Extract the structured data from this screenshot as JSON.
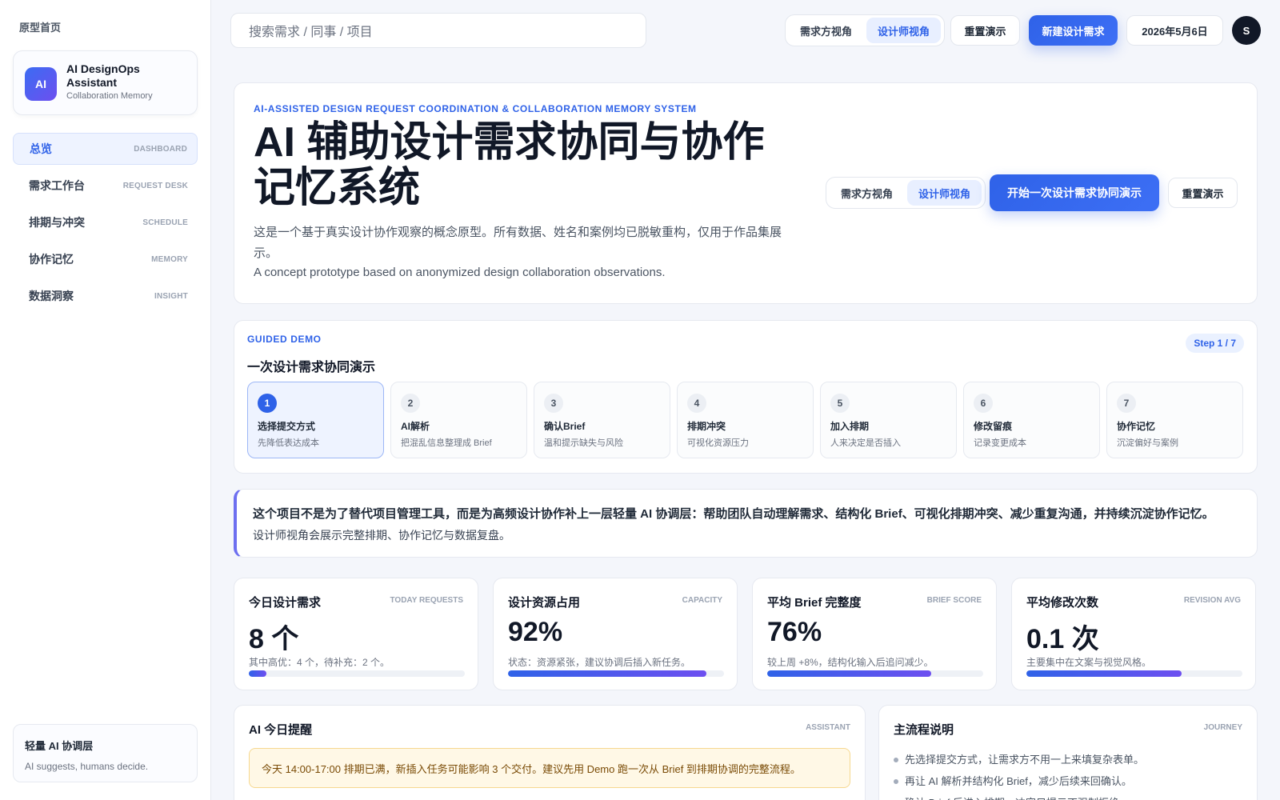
{
  "sidebar": {
    "home_label": "原型首页",
    "brand": {
      "logo": "AI",
      "name": "AI DesignOps Assistant",
      "subtitle": "Collaboration Memory"
    },
    "items": [
      {
        "label": "总览",
        "en": "DASHBOARD",
        "active": true
      },
      {
        "label": "需求工作台",
        "en": "REQUEST DESK"
      },
      {
        "label": "排期与冲突",
        "en": "SCHEDULE"
      },
      {
        "label": "协作记忆",
        "en": "MEMORY"
      },
      {
        "label": "数据洞察",
        "en": "INSIGHT"
      }
    ],
    "footer": {
      "title": "轻量 AI 协调层",
      "subtitle": "AI suggests, humans decide."
    }
  },
  "topbar": {
    "search_placeholder": "搜索需求 / 同事 / 项目",
    "view_toggle": [
      "需求方视角",
      "设计师视角"
    ],
    "active_view": "设计师视角",
    "reset_label": "重置演示",
    "new_request_label": "新建设计需求",
    "date": "2026年5月6日",
    "avatar_initial": "S"
  },
  "hero": {
    "eyebrow": "AI-ASSISTED DESIGN REQUEST COORDINATION & COLLABORATION MEMORY SYSTEM",
    "title": "AI 辅助设计需求协同与协作记忆系统",
    "description_zh": "这是一个基于真实设计协作观察的概念原型。所有数据、姓名和案例均已脱敏重构，仅用于作品集展示。",
    "description_en": "A concept prototype based on anonymized design collaboration observations.",
    "view_toggle": [
      "需求方视角",
      "设计师视角"
    ],
    "start_demo_label": "开始一次设计需求协同演示",
    "reset_label": "重置演示"
  },
  "demo": {
    "eyebrow": "GUIDED DEMO",
    "title": "一次设计需求协同演示",
    "step_badge": "Step 1 / 7",
    "steps": [
      {
        "num": "1",
        "title": "选择提交方式",
        "sub": "先降低表达成本",
        "active": true
      },
      {
        "num": "2",
        "title": "AI解析",
        "sub": "把混乱信息整理成 Brief"
      },
      {
        "num": "3",
        "title": "确认Brief",
        "sub": "温和提示缺失与风险"
      },
      {
        "num": "4",
        "title": "排期冲突",
        "sub": "可视化资源压力"
      },
      {
        "num": "5",
        "title": "加入排期",
        "sub": "人来决定是否插入"
      },
      {
        "num": "6",
        "title": "修改留痕",
        "sub": "记录变更成本"
      },
      {
        "num": "7",
        "title": "协作记忆",
        "sub": "沉淀偏好与案例"
      }
    ]
  },
  "notice": {
    "main": "这个项目不是为了替代项目管理工具，而是为高频设计协作补上一层轻量 AI 协调层：帮助团队自动理解需求、结构化 Brief、可视化排期冲突、减少重复沟通，并持续沉淀协作记忆。",
    "sub": "设计师视角会展示完整排期、协作记忆与数据复盘。"
  },
  "stats": [
    {
      "title": "今日设计需求",
      "en": "TODAY REQUESTS",
      "value": "8 个",
      "desc": "其中高优：4 个，待补充：2 个。",
      "progress": 0.08
    },
    {
      "title": "设计资源占用",
      "en": "CAPACITY",
      "value": "92%",
      "desc": "状态：资源紧张，建议协调后插入新任务。",
      "progress": 0.92
    },
    {
      "title": "平均 Brief 完整度",
      "en": "BRIEF SCORE",
      "value": "76%",
      "desc": "较上周 +8%，结构化输入后追问减少。",
      "progress": 0.76
    },
    {
      "title": "平均修改次数",
      "en": "REVISION AVG",
      "value": "0.1 次",
      "desc": "主要集中在文案与视觉风格。",
      "progress": 0.72
    }
  ],
  "assistant": {
    "title": "AI 今日提醒",
    "en": "ASSISTANT",
    "alert": "今天 14:00-17:00 排期已满，新插入任务可能影响 3 个交付。建议先用 Demo 跑一次从 Brief 到排期协调的完整流程。"
  },
  "journey": {
    "title": "主流程说明",
    "en": "JOURNEY",
    "items": [
      "先选择提交方式，让需求方不用一上来填复杂表单。",
      "再让 AI 解析并结构化 Brief，减少后续来回确认。",
      "确认 Brief 后进入排期，冲突只提示不强制拒绝。"
    ]
  }
}
